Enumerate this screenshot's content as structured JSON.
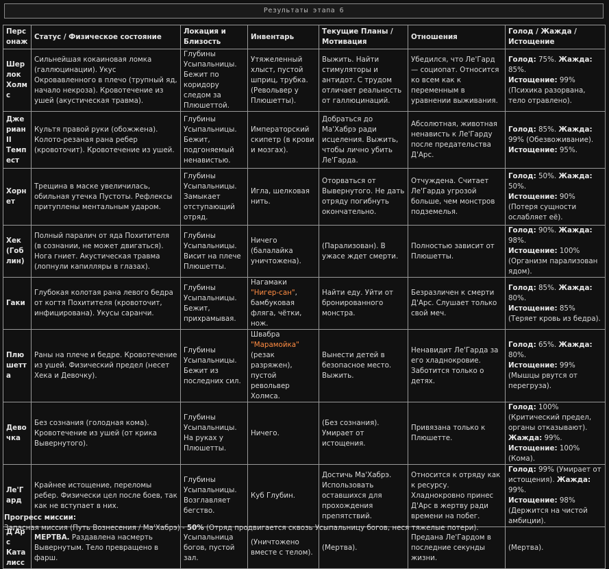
{
  "header": {
    "title": "Результаты этапа 6"
  },
  "table": {
    "columns": [
      "Персонаж",
      "Статус / Физическое состояние",
      "Локация и Близость",
      "Инвентарь",
      "Текущие Планы / Мотивация",
      "Отношения",
      "Голод / Жажда / Истощение"
    ],
    "labels": {
      "hunger": "Голод:",
      "thirst": "Жажда:",
      "exhaustion": "Истощение:",
      "fatal": "МЕРТВА."
    },
    "rows": [
      {
        "name": "Шерлок Холмс",
        "status": "Сильнейшая кокаиновая ломка (галлюцинации). Укус Окровавленного в плечо (трупный яд, начало некроза). Кровотечение из ушей (акустическая травма).",
        "location": "Глубины Усыпальницы. Бежит по коридору следом за Плюшеттой.",
        "inventory": "Утяжеленный хлыст, пустой шприц, трубка. (Револьвер у Плюшетты).",
        "plans": "Выжить. Найти стимуляторы и антидот. С трудом отличает реальность от галлюцинаций.",
        "relations": "Убедился, что Ле'Гард — социопат. Относится ко всем как к переменным в уравнении выживания.",
        "vitals": {
          "hunger": "75%.",
          "thirst": "85%.",
          "exhaustion": "99% (Психика разорвана, тело отравлено)."
        }
      },
      {
        "name": "Джериан II Темпест",
        "status": "Культя правой руки (обожжена). Колото-резаная рана ребер (кровоточит). Кровотечение из ушей.",
        "location": "Глубины Усыпальницы. Бежит, подгоняемый ненавистью.",
        "inventory": "Императорский скипетр (в крови и мозгах).",
        "plans": "Добраться до Ма'Хабрэ ради исцеления. Выжить, чтобы лично убить Ле'Гарда.",
        "relations": "Абсолютная, животная ненависть к Ле'Гарду после предательства Д'Арс.",
        "vitals": {
          "hunger": "85%.",
          "thirst": "99% (Обезвоживание).",
          "exhaustion": "95%."
        }
      },
      {
        "name": "Хорнет",
        "status": "Трещина в маске увеличилась, обильная утечка Пустоты. Рефлексы притуплены ментальным ударом.",
        "location": "Глубины Усыпальницы. Замыкает отступающий отряд.",
        "inventory": "Игла, шелковая нить.",
        "plans": "Оторваться от Вывернутого. Не дать отряду погибнуть окончательно.",
        "relations": "Отчуждена. Считает Ле'Гарда угрозой больше, чем монстров подземелья.",
        "vitals": {
          "hunger": "50%.",
          "thirst": "50%.",
          "exhaustion": "90% (Потеря сущности ослабляет её)."
        }
      },
      {
        "name": "Хек (Гоблин)",
        "status": "Полный паралич от яда Похитителя (в сознании, не может двигаться). Нога гниет. Акустическая травма (лопнули капилляры в глазах).",
        "location": "Глубины Усыпальницы. Висит на плече Плюшетты.",
        "inventory": "Ничего (балалайка уничтожена).",
        "plans": "(Парализован). В ужасе ждет смерти.",
        "relations": "Полностью зависит от Плюшетты.",
        "vitals": {
          "hunger": "90%.",
          "thirst": "98%.",
          "exhaustion": "100% (Организм парализован ядом)."
        }
      },
      {
        "name": "Гаки",
        "status": "Глубокая колотая рана левого бедра от когтя Похитителя (кровоточит, инфицирована). Укусы саранчи.",
        "location": "Глубины Усыпальницы. Бежит, прихрамывая.",
        "inventory": {
          "before": "Нагамаки ",
          "highlight": "\"Нигер-сан\"",
          "after": ", бамбуковая фляга, чётки, нож."
        },
        "plans": "Найти еду. Уйти от бронированного монстра.",
        "relations": "Безразличен к смерти Д'Арс. Слушает только свой меч.",
        "vitals": {
          "hunger": "85%.",
          "thirst": "80%.",
          "exhaustion": "85% (Теряет кровь из бедра)."
        }
      },
      {
        "name": "Плюшетта",
        "status": "Раны на плече и бедре. Кровотечение из ушей. Физический предел (несет Хека и Девочку).",
        "location": "Глубины Усыпальницы. Бежит из последних сил.",
        "inventory": {
          "before": "Швабра ",
          "highlight": "\"Марамойка\"",
          "after": " (резак разряжен), пустой револьвер Холмса."
        },
        "plans": "Вынести детей в безопасное место. Выжить.",
        "relations": "Ненавидит Ле'Гарда за его хладнокровие. Заботится только о детях.",
        "vitals": {
          "hunger": "65%.",
          "thirst": "80%.",
          "exhaustion": "99% (Мышцы рвутся от перегруза)."
        }
      },
      {
        "name": "Девочка",
        "status": "Без сознания (голодная кома). Кровотечение из ушей (от крика Вывернутого).",
        "location": "Глубины Усыпальницы. На руках у Плюшетты.",
        "inventory": "Ничего.",
        "plans": "(Без сознания). Умирает от истощения.",
        "relations": "Привязана только к Плюшетте.",
        "vitals": {
          "hunger": "100% (Критический предел, органы отказывают).",
          "thirst": "99%.",
          "exhaustion": "100% (Кома)."
        }
      },
      {
        "name": "Ле'Гард",
        "status": "Крайнее истощение, переломы ребер. Физически цел после боев, так как не вступает в них.",
        "location": "Глубины Усыпальницы. Возглавляет бегство.",
        "inventory": "Куб Глубин.",
        "plans": "Достичь Ма'Хабрэ. Использовать оставшихся для прохождения препятствий.",
        "relations": "Относится к отряду как к ресурсу. Хладнокровно принес Д'Арс в жертву ради времени на побег.",
        "vitals": {
          "hunger": "99% (Умирает от истощения).",
          "thirst": "99%.",
          "exhaustion": "98% (Держится на чистой амбиции)."
        }
      },
      {
        "name": "Д'Арс Каталисс",
        "status_rest": " Раздавлена насмерть Вывернутым. Тело превращено в фарш.",
        "location": "Усыпальница богов, пустой зал.",
        "inventory": "(Уничтожено вместе с телом).",
        "plans": "(Мертва).",
        "relations": "Предана Ле'Гардом в последние секунды жизни.",
        "vitals_text": "(Мертва)."
      }
    ]
  },
  "footer": {
    "progress_title": "Прогресс миссии:",
    "mission_name": "Запасная миссия (Путь Вознесения / Ма'Хабрэ) - ",
    "mission_percent": "50%",
    "mission_note": " (Отряд продвигается сквозь Усыпальницу богов, неся тяжелые потери)."
  }
}
